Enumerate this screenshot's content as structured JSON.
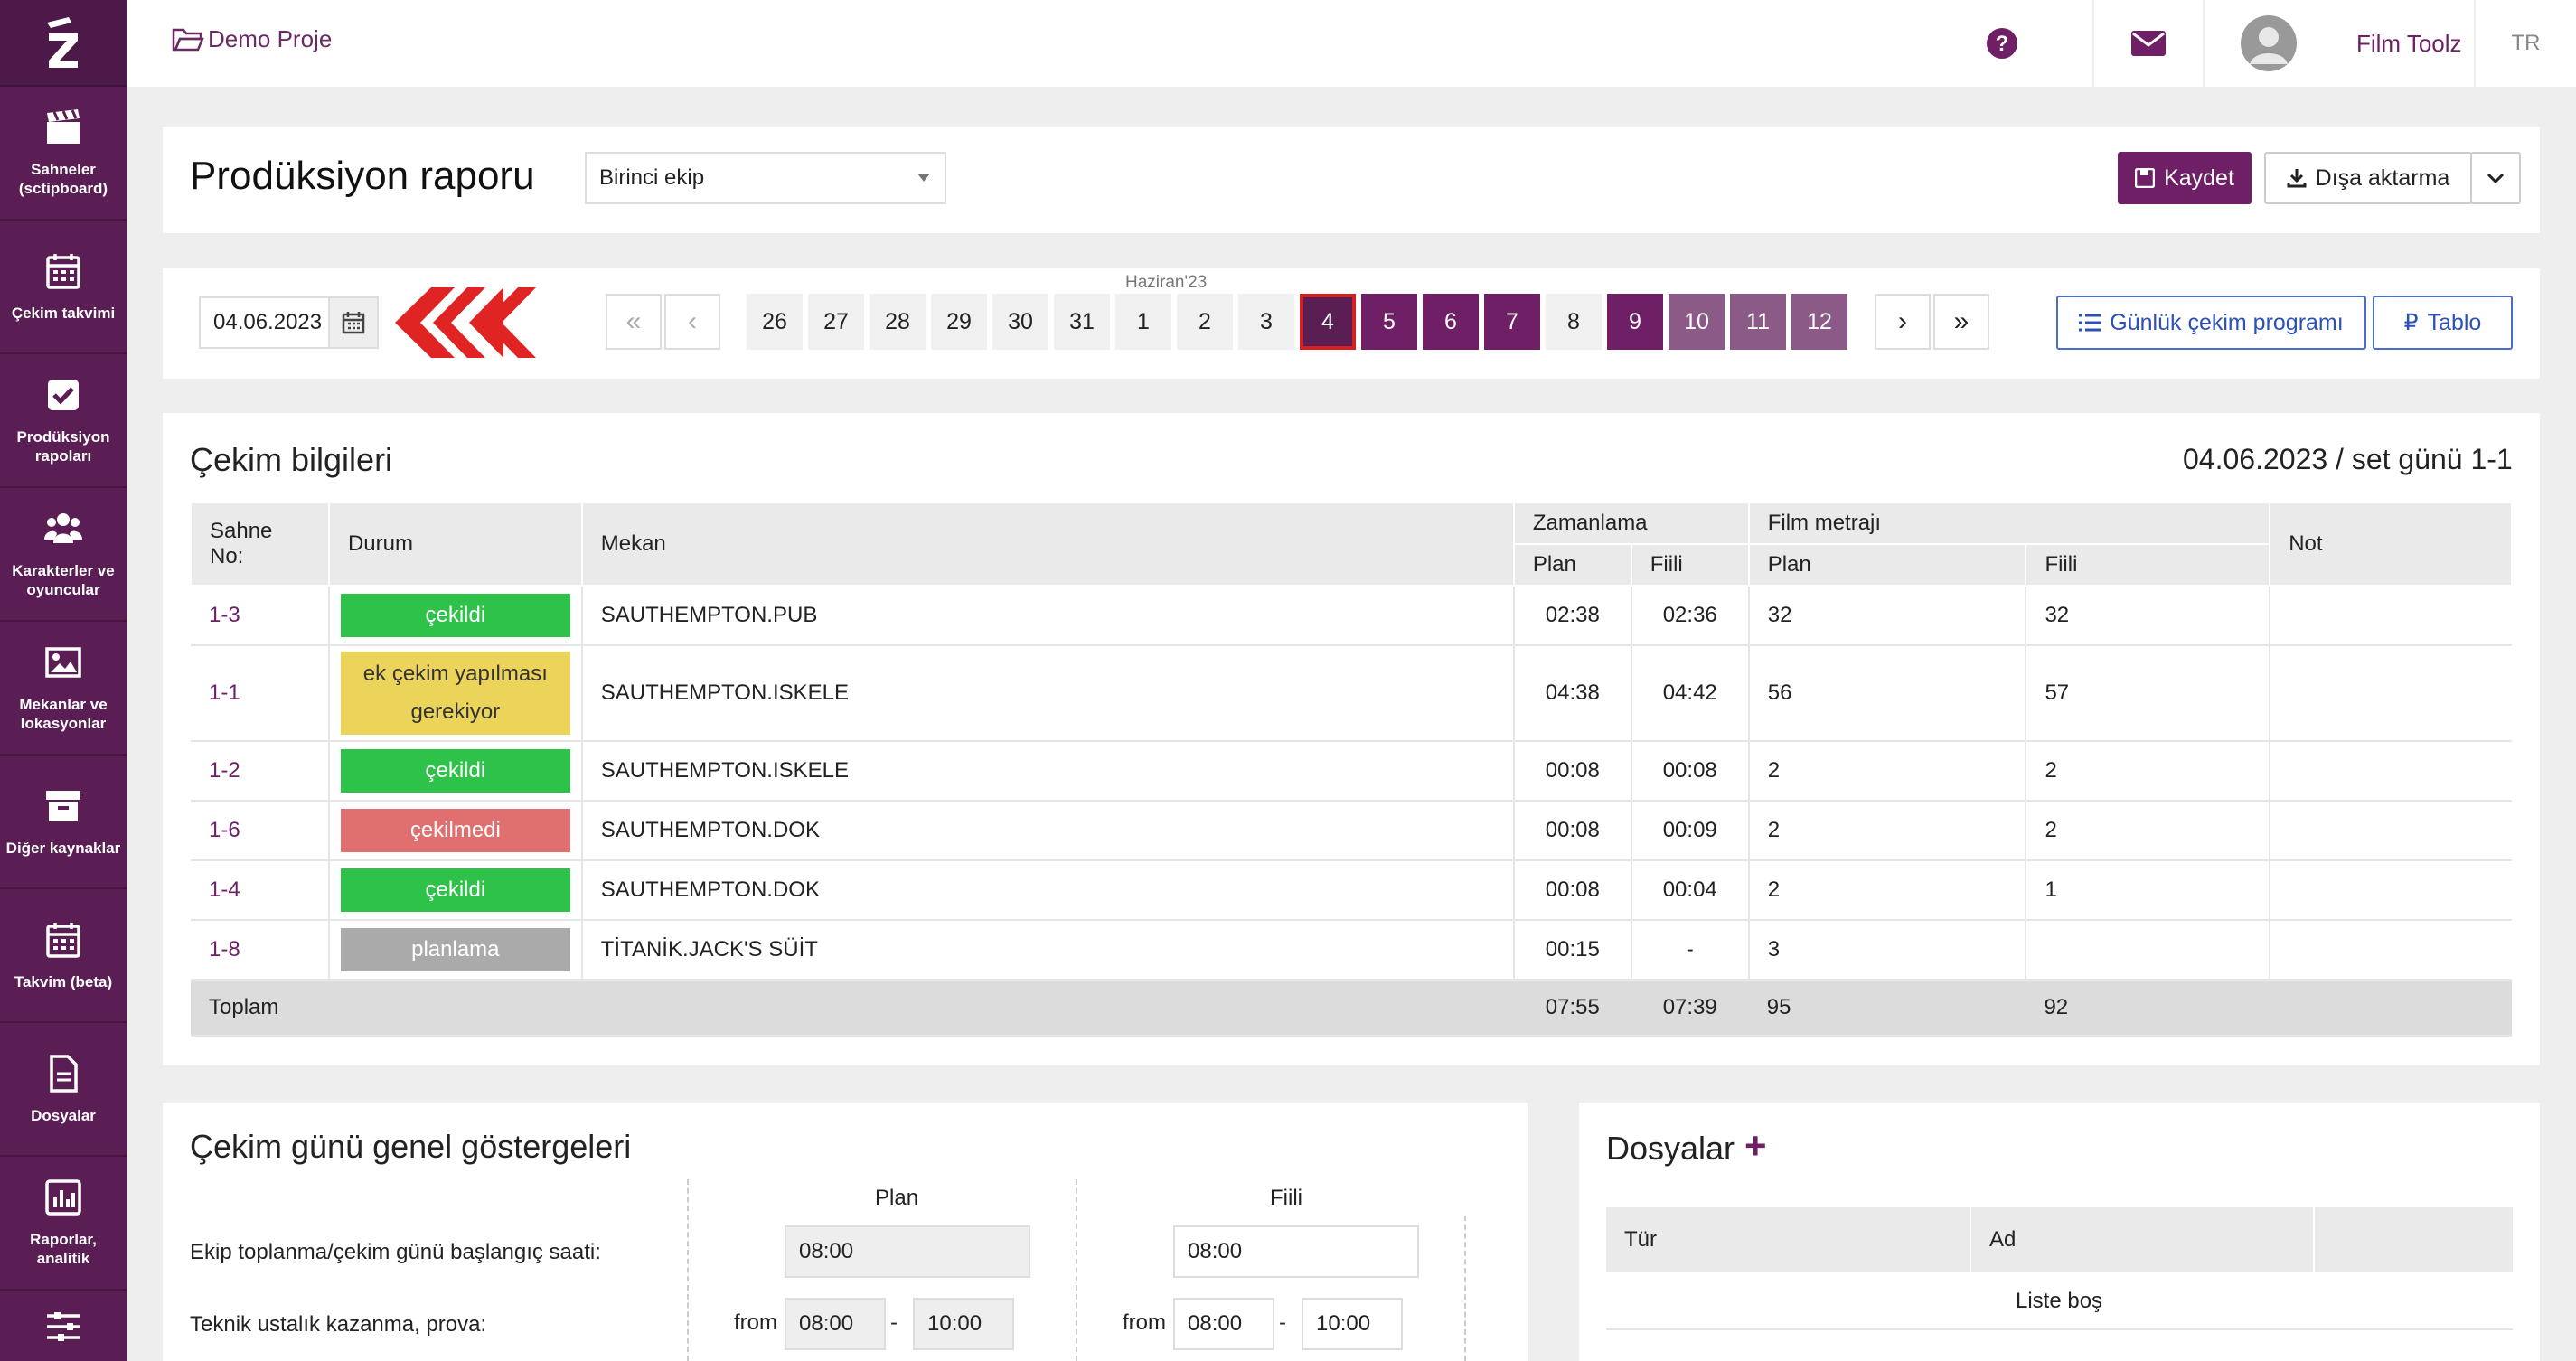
{
  "sidebar": {
    "items": [
      {
        "label": "Sahneler (sctipboard)",
        "icon": "clapperboard-icon"
      },
      {
        "label": "Çekim takvimi",
        "icon": "calendar-icon"
      },
      {
        "label": "Prodüksiyon rapoları",
        "icon": "check-square-icon"
      },
      {
        "label": "Karakterler ve oyuncular",
        "icon": "users-icon"
      },
      {
        "label": "Mekanlar ve lokasyonlar",
        "icon": "image-icon"
      },
      {
        "label": "Diğer kaynaklar",
        "icon": "archive-icon"
      },
      {
        "label": "Takvim (beta)",
        "icon": "calendar-icon"
      },
      {
        "label": "Dosyalar",
        "icon": "file-icon"
      },
      {
        "label": "Raporlar, analitik",
        "icon": "chart-icon"
      },
      {
        "label": "",
        "icon": "sliders-icon"
      }
    ]
  },
  "header": {
    "breadcrumb": "Demo Proje",
    "user_name": "Film Toolz",
    "lang": "TR"
  },
  "toolbar": {
    "title": "Prodüksiyon raporu",
    "crew_select": "Birinci ekip",
    "save_label": "Kaydet",
    "export_label": "Dışa aktarma"
  },
  "datebar": {
    "date_value": "04.06.2023",
    "month_label": "Haziran'23",
    "first": "«",
    "prev": "‹",
    "next": "›",
    "last": "»",
    "days": [
      {
        "n": "26",
        "s": "n"
      },
      {
        "n": "27",
        "s": "n"
      },
      {
        "n": "28",
        "s": "n"
      },
      {
        "n": "29",
        "s": "n"
      },
      {
        "n": "30",
        "s": "n"
      },
      {
        "n": "31",
        "s": "n"
      },
      {
        "n": "1",
        "s": "n"
      },
      {
        "n": "2",
        "s": "n"
      },
      {
        "n": "3",
        "s": "n"
      },
      {
        "n": "4",
        "s": "sel"
      },
      {
        "n": "5",
        "s": "dp"
      },
      {
        "n": "6",
        "s": "dp"
      },
      {
        "n": "7",
        "s": "dp"
      },
      {
        "n": "8",
        "s": "n"
      },
      {
        "n": "9",
        "s": "dp"
      },
      {
        "n": "10",
        "s": "lp"
      },
      {
        "n": "11",
        "s": "lp"
      },
      {
        "n": "12",
        "s": "lp"
      }
    ],
    "daily_schedule_label": "Günlük çekim programı",
    "table_label": "Tablo"
  },
  "shoot": {
    "title": "Çekim bilgileri",
    "date_info": "04.06.2023 / set günü 1-1",
    "headers": {
      "scene": "Sahne No:",
      "status": "Durum",
      "location": "Mekan",
      "timing": "Zamanlama",
      "film": "Film metrajı",
      "note": "Not",
      "plan": "Plan",
      "actual": "Fiili"
    },
    "rows": [
      {
        "scene": "1-3",
        "status": "çekildi",
        "st": "green",
        "location": "SAUTHEMPTON.PUB",
        "tp": "02:38",
        "ta": "02:36",
        "fp": "32",
        "fa": "32",
        "note": ""
      },
      {
        "scene": "1-1",
        "status": "ek çekim yapılması gerekiyor",
        "st": "yellow",
        "location": "SAUTHEMPTON.ISKELE",
        "tp": "04:38",
        "ta": "04:42",
        "fp": "56",
        "fa": "57",
        "note": ""
      },
      {
        "scene": "1-2",
        "status": "çekildi",
        "st": "green",
        "location": "SAUTHEMPTON.ISKELE",
        "tp": "00:08",
        "ta": "00:08",
        "fp": "2",
        "fa": "2",
        "note": ""
      },
      {
        "scene": "1-6",
        "status": "çekilmedi",
        "st": "red",
        "location": "SAUTHEMPTON.DOK",
        "tp": "00:08",
        "ta": "00:09",
        "fp": "2",
        "fa": "2",
        "note": ""
      },
      {
        "scene": "1-4",
        "status": "çekildi",
        "st": "green",
        "location": "SAUTHEMPTON.DOK",
        "tp": "00:08",
        "ta": "00:04",
        "fp": "2",
        "fa": "1",
        "note": ""
      },
      {
        "scene": "1-8",
        "status": "planlama",
        "st": "grey",
        "location": "TİTANİK.JACK'S SÜİT",
        "tp": "00:15",
        "ta": "-",
        "fp": "3",
        "fa": "",
        "note": ""
      }
    ],
    "total": {
      "label": "Toplam",
      "tp": "07:55",
      "ta": "07:39",
      "fp": "95",
      "fa": "92"
    }
  },
  "indicators": {
    "title": "Çekim günü genel göstergeleri",
    "plan": "Plan",
    "actual": "Fiili",
    "row1_label": "Ekip toplanma/çekim günü başlangıç saati:",
    "row1_plan": "08:00",
    "row1_actual": "08:00",
    "row2_label": "Teknik ustalık kazanma, prova:",
    "from": "from",
    "dash": "-",
    "row2_plan_from": "08:00",
    "row2_plan_to": "10:00",
    "row2_actual_from": "08:00",
    "row2_actual_to": "10:00"
  },
  "files": {
    "title": "Dosyalar",
    "add": "+",
    "col_type": "Tür",
    "col_name": "Ad",
    "empty": "Liste boş"
  },
  "colors": {
    "primary": "#6e1f66",
    "sidebar": "#5a1e55",
    "green": "#2fc24b",
    "yellow": "#ecd45b",
    "red": "#e07070",
    "grey": "#aaaaaa"
  }
}
